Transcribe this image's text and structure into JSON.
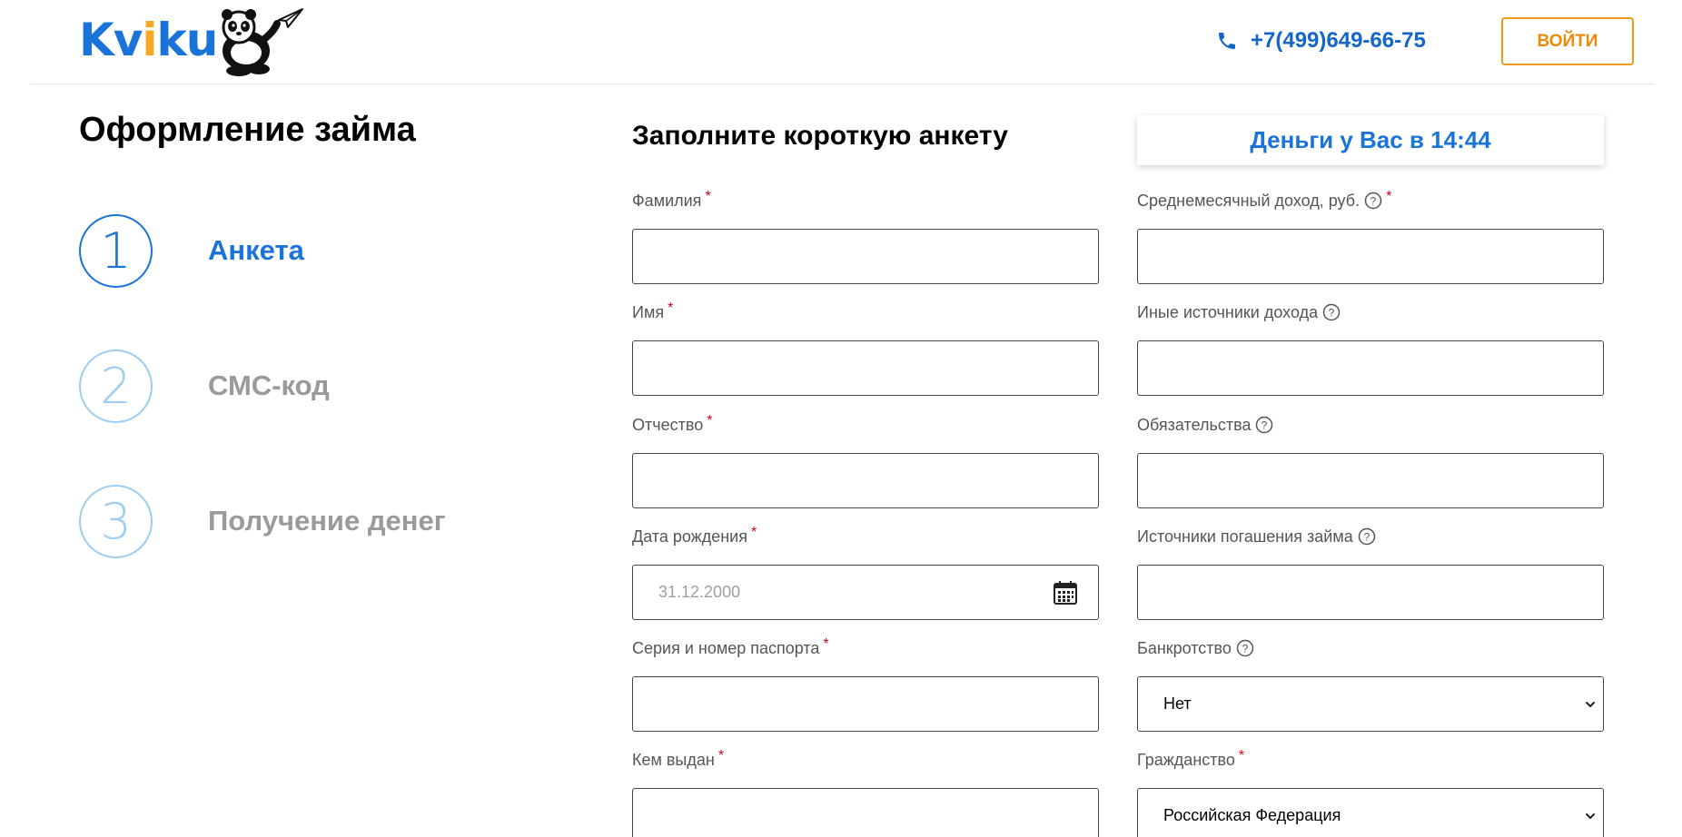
{
  "header": {
    "logo": {
      "text_part1": "Kv",
      "text_accent": "i",
      "text_part2": "ku"
    },
    "phone": "+7(499)649-66-75",
    "login_label": "ВОЙТИ"
  },
  "page_title": "Оформление займа",
  "steps": [
    {
      "number": "1",
      "label": "Анкета",
      "active": true
    },
    {
      "number": "2",
      "label": "СМС-код",
      "active": false
    },
    {
      "number": "3",
      "label": "Получение денег",
      "active": false
    }
  ],
  "form": {
    "title": "Заполните короткую анкету",
    "timer": "Деньги у Вас в 14:44",
    "fields_left": [
      {
        "label": "Фамилия",
        "required": "*",
        "value": ""
      },
      {
        "label": "Имя",
        "required": "*",
        "value": ""
      },
      {
        "label": "Отчество",
        "required": "*",
        "value": ""
      },
      {
        "label": "Дата рождения",
        "required": "*",
        "placeholder": "31.12.2000"
      },
      {
        "label": "Серия и номер паспорта",
        "required": "*",
        "value": ""
      },
      {
        "label": "Кем выдан",
        "required": "*",
        "value": ""
      }
    ],
    "fields_right": [
      {
        "label": "Среднемесячный доход, руб.",
        "required": "*",
        "value": ""
      },
      {
        "label": "Иные источники дохода",
        "value": ""
      },
      {
        "label": "Обязательства",
        "value": ""
      },
      {
        "label": "Источники погашения займа",
        "value": ""
      },
      {
        "label": "Банкротство",
        "selected": "Нет"
      },
      {
        "label": "Гражданство",
        "required": "*",
        "selected": "Российская Федерация"
      }
    ]
  },
  "colors": {
    "brand_blue": "#1a73d9",
    "accent_orange": "#f19a1a",
    "inactive_step": "#9dcdf2",
    "required_red": "#d0021b"
  },
  "icons": [
    "panda-logo-icon",
    "phone-icon",
    "help-icon",
    "calendar-icon",
    "chevron-down-icon"
  ]
}
